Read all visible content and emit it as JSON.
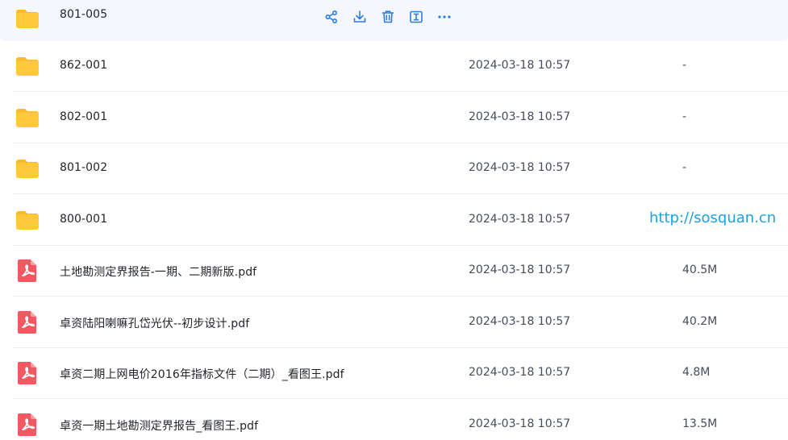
{
  "colors": {
    "folder": "#FFC93A",
    "pdf": "#F0595F",
    "action_icon": "#2a7de1",
    "watermark": "#1aa0e8",
    "hover_bg": "#f5f7fc"
  },
  "hovered_row": {
    "name": "801-005",
    "icon": "folder-icon",
    "actions": [
      {
        "name": "share-icon"
      },
      {
        "name": "download-icon"
      },
      {
        "name": "delete-icon"
      },
      {
        "name": "rename-icon"
      },
      {
        "name": "more-icon"
      }
    ]
  },
  "files": [
    {
      "name": "862-001",
      "type": "folder",
      "modified": "2024-03-18 10:57",
      "size": "-"
    },
    {
      "name": "802-001",
      "type": "folder",
      "modified": "2024-03-18 10:57",
      "size": "-"
    },
    {
      "name": "801-002",
      "type": "folder",
      "modified": "2024-03-18 10:57",
      "size": "-"
    },
    {
      "name": "800-001",
      "type": "folder",
      "modified": "2024-03-18 10:57",
      "size": ""
    },
    {
      "name": "土地勘测定界报告-一期、二期新版.pdf",
      "type": "pdf",
      "modified": "2024-03-18 10:57",
      "size": "40.5M"
    },
    {
      "name": "卓资陆阳喇嘛孔岱光伏--初步设计.pdf",
      "type": "pdf",
      "modified": "2024-03-18 10:57",
      "size": "40.2M"
    },
    {
      "name": "卓资二期上网电价2016年指标文件（二期）_看图王.pdf",
      "type": "pdf",
      "modified": "2024-03-18 10:57",
      "size": "4.8M"
    },
    {
      "name": "卓资一期土地勘测定界报告_看图王.pdf",
      "type": "pdf",
      "modified": "2024-03-18 10:57",
      "size": "13.5M"
    }
  ],
  "watermark": "http://sosquan.cn"
}
